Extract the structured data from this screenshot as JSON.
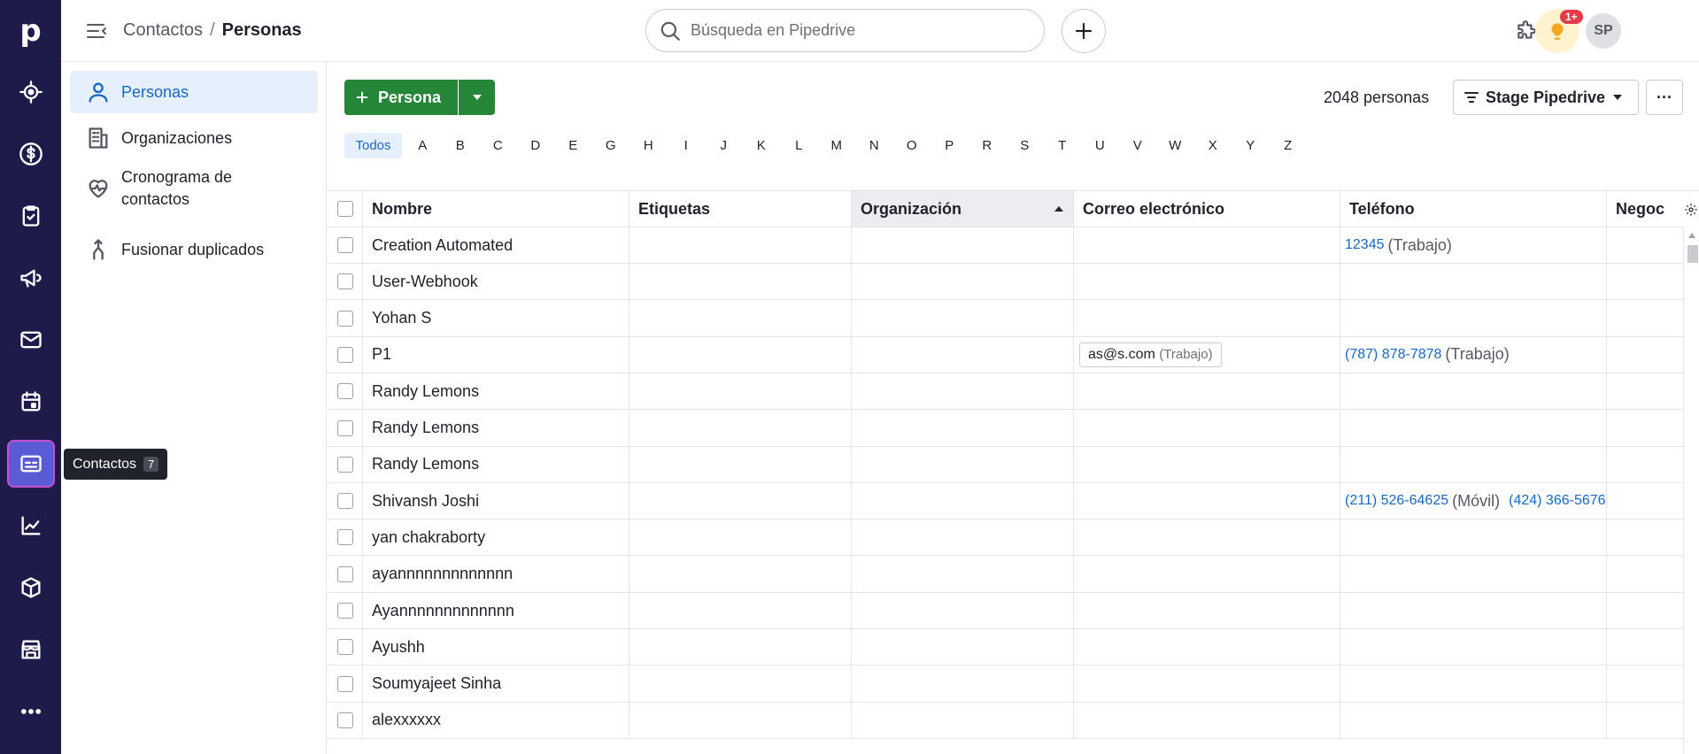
{
  "rail": {
    "logo": "p",
    "tooltip": {
      "label": "Contactos",
      "shortcut": "7"
    }
  },
  "topbar": {
    "breadcrumb_parent": "Contactos",
    "breadcrumb_sep": "/",
    "breadcrumb_current": "Personas",
    "search_placeholder": "Búsqueda en Pipedrive",
    "notification_badge": "1+",
    "avatar_initials": "SP"
  },
  "sidebar": {
    "items": [
      {
        "label": "Personas",
        "icon": "person-icon"
      },
      {
        "label": "Organizaciones",
        "icon": "building-icon"
      },
      {
        "label": "Cronograma de contactos",
        "icon": "heart-pulse-icon"
      },
      {
        "label": "Fusionar duplicados",
        "icon": "merge-icon"
      }
    ]
  },
  "toolbar": {
    "add_label": "Persona",
    "count_label": "2048 personas",
    "filter_label": "Stage Pipedrive",
    "more_label": "···"
  },
  "alphabet": [
    "Todos",
    "A",
    "B",
    "C",
    "D",
    "E",
    "G",
    "H",
    "I",
    "J",
    "K",
    "L",
    "M",
    "N",
    "O",
    "P",
    "R",
    "S",
    "T",
    "U",
    "V",
    "W",
    "X",
    "Y",
    "Z"
  ],
  "table": {
    "columns": [
      "Nombre",
      "Etiquetas",
      "Organización",
      "Correo electrónico",
      "Teléfono",
      "Negoc"
    ],
    "rows": [
      {
        "name": "Creation Automated",
        "email": "",
        "email_type": "",
        "phones": [
          {
            "number": "12345",
            "type": "(Trabajo)"
          }
        ]
      },
      {
        "name": "User-Webhook",
        "email": "",
        "email_type": "",
        "phones": []
      },
      {
        "name": "Yohan S",
        "email": "",
        "email_type": "",
        "phones": []
      },
      {
        "name": "P1",
        "email": "as@s.com",
        "email_type": "(Trabajo)",
        "phones": [
          {
            "number": "(787) 878-7878",
            "type": "(Trabajo)"
          }
        ]
      },
      {
        "name": "Randy Lemons",
        "email": "",
        "email_type": "",
        "phones": []
      },
      {
        "name": "Randy Lemons",
        "email": "",
        "email_type": "",
        "phones": []
      },
      {
        "name": "Randy Lemons",
        "email": "",
        "email_type": "",
        "phones": []
      },
      {
        "name": "Shivansh Joshi",
        "email": "",
        "email_type": "",
        "phones": [
          {
            "number": "(211) 526-64625",
            "type": "(Móvil)"
          },
          {
            "number": "(424) 366-5676",
            "type": ""
          }
        ]
      },
      {
        "name": "yan chakraborty",
        "email": "",
        "email_type": "",
        "phones": []
      },
      {
        "name": "ayannnnnnnnnnnnn",
        "email": "",
        "email_type": "",
        "phones": []
      },
      {
        "name": "Ayannnnnnnnnnnnn",
        "email": "",
        "email_type": "",
        "phones": []
      },
      {
        "name": "Ayushh",
        "email": "",
        "email_type": "",
        "phones": []
      },
      {
        "name": "Soumyajeet Sinha",
        "email": "",
        "email_type": "",
        "phones": []
      },
      {
        "name": "alexxxxxx",
        "email": "",
        "email_type": "",
        "phones": []
      }
    ]
  }
}
